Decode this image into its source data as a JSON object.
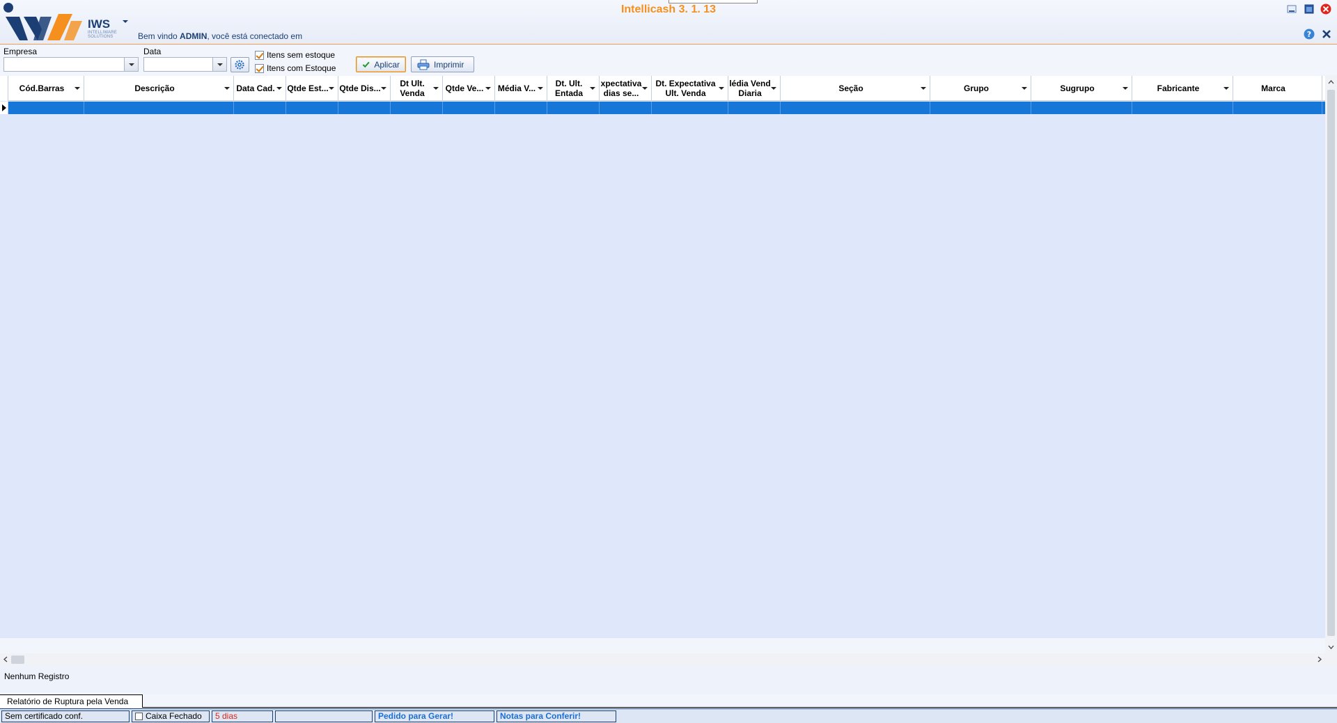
{
  "app": {
    "title": "Intellicash 3. 1. 13",
    "brand_name": "IWS",
    "brand_sub": "INTELLIWARE SOLUTIONS",
    "welcome_prefix": "Bem vindo ",
    "welcome_user": "ADMIN",
    "welcome_suffix": ", você está conectado em",
    "accent_color": "#f5901e",
    "brand_color": "#1b3f74"
  },
  "filters": {
    "empresa_label": "Empresa",
    "empresa_value": "",
    "data_label": "Data",
    "data_value": "",
    "chk_sem_estoque": {
      "label": "Itens sem estoque",
      "checked": true
    },
    "chk_com_estoque": {
      "label": "Itens com Estoque",
      "checked": true
    },
    "aplicar_label": "Aplicar",
    "imprimir_label": "Imprimir"
  },
  "grid": {
    "columns": [
      {
        "key": "cod_barras",
        "label": "Cód.Barras",
        "sortable": true
      },
      {
        "key": "descricao",
        "label": "Descrição",
        "sortable": true
      },
      {
        "key": "data_cad",
        "label": "Data Cad.",
        "sortable": true
      },
      {
        "key": "qtde_est",
        "label": "Qtde Est...",
        "sortable": true
      },
      {
        "key": "qtde_dis",
        "label": "Qtde Dis...",
        "sortable": true
      },
      {
        "key": "dt_ult_venda",
        "label": "Dt Ult.\nVenda",
        "sortable": true
      },
      {
        "key": "qtde_ve",
        "label": "Qtde Ve...",
        "sortable": true
      },
      {
        "key": "media_v",
        "label": "Média V...",
        "sortable": true
      },
      {
        "key": "dt_ult_entada",
        "label": "Dt. Ult.\nEntada",
        "sortable": true
      },
      {
        "key": "expectativa_dias",
        "label": "xpectativa\ndias se...",
        "sortable": true
      },
      {
        "key": "dt_expectativa",
        "label": "Dt. Expectativa\nUlt. Venda",
        "sortable": true
      },
      {
        "key": "media_vend_diaria",
        "label": "lédia Vend\nDiaria",
        "sortable": true
      },
      {
        "key": "secao",
        "label": "Seção",
        "sortable": true
      },
      {
        "key": "grupo",
        "label": "Grupo",
        "sortable": true
      },
      {
        "key": "sugrupo",
        "label": "Sugrupo",
        "sortable": true
      },
      {
        "key": "fabricante",
        "label": "Fabricante",
        "sortable": true
      },
      {
        "key": "marca",
        "label": "Marca",
        "sortable": false
      }
    ],
    "rows": [],
    "selection_color": "#1777d9"
  },
  "footer": {
    "records_text": "Nenhum Registro",
    "tab_label": "Relatório de Ruptura pela Venda"
  },
  "status": {
    "certificado": "Sem certificado conf.",
    "caixa": "Caixa Fechado",
    "dias": "5 dias",
    "empty": "",
    "pedido": "Pedido para Gerar!",
    "notas": "Notas para Conferir!"
  }
}
